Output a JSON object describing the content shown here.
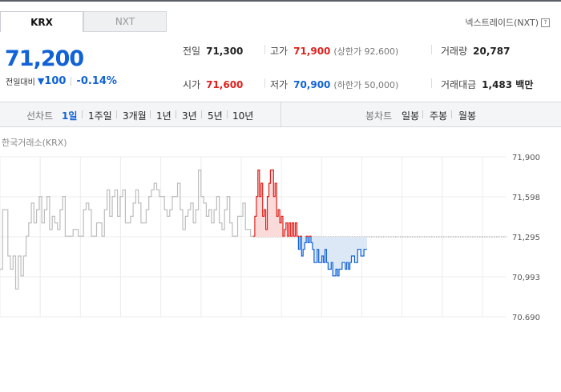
{
  "tabs": [
    {
      "label": "KRX",
      "active": true
    },
    {
      "label": "NXT",
      "active": false
    }
  ],
  "nxt_link": {
    "label": "넥스트레이드(NXT)",
    "help_icon": "?"
  },
  "price": {
    "current": "71,200",
    "change_label": "전일대비",
    "change_direction": "down",
    "change_arrow": "▼",
    "change": "100",
    "change_pct": "-0.14%"
  },
  "stats": {
    "prev_close": {
      "label": "전일",
      "value": "71,300"
    },
    "high": {
      "label": "고가",
      "value": "71,900",
      "sub": "(상한가 92,600)"
    },
    "volume": {
      "label": "거래량",
      "value": "20,787"
    },
    "open": {
      "label": "시가",
      "value": "71,600"
    },
    "low": {
      "label": "저가",
      "value": "70,900",
      "sub": "(하한가 50,000)"
    },
    "amount": {
      "label": "거래대금",
      "value": "1,483 백만"
    }
  },
  "period_bar": {
    "line_label": "선차트",
    "line_options": [
      "1일",
      "1주일",
      "3개월",
      "1년",
      "3년",
      "5년",
      "10년"
    ],
    "selected": "1일",
    "candle_label": "봉차트",
    "candle_options": [
      "일봉",
      "주봉",
      "월봉"
    ]
  },
  "chart_data": {
    "type": "line",
    "exchange_label": "한국거래소(KRX)",
    "y_ticks": [
      "71,900",
      "71,598",
      "71,295",
      "70,993",
      "70,690"
    ],
    "ylim": [
      70690,
      71900
    ],
    "baseline": 71295,
    "grid": true,
    "colors": {
      "pre": "#bdbdbd",
      "up": "#e0201c",
      "up_fill": "#fbdada",
      "down": "#1062d6",
      "down_fill": "#dde8f6",
      "baseline": "#777777"
    },
    "series": [
      {
        "session": "pre-market",
        "values": [
          71050,
          71500,
          71500,
          71150,
          71050,
          71150,
          70900,
          71150,
          71000,
          71150,
          71300,
          71400,
          71550,
          71400,
          71500,
          71600,
          71400,
          71500,
          71600,
          71350,
          71450,
          71400,
          71350,
          71500,
          71600,
          71300,
          71300,
          71300,
          71350,
          71350,
          71300,
          71300,
          71500,
          71550,
          71500,
          71300,
          71300,
          71400,
          71400,
          71300,
          71500,
          71650,
          71450,
          71600,
          71650,
          71450,
          71600,
          71650,
          71400,
          71400,
          71450,
          71550,
          71650,
          71550,
          71400,
          71400,
          71500,
          71600,
          71650,
          71700,
          71650,
          71600,
          71600,
          71500,
          71450,
          71500,
          71600,
          71600,
          71700,
          71500,
          71350,
          71450,
          71500,
          71550,
          71400,
          71500,
          71800,
          71600,
          71550,
          71450,
          71500,
          71400,
          71500,
          71600,
          71400,
          71350,
          71500,
          71600,
          71400,
          71300,
          71300,
          71450,
          71450,
          71550,
          71350,
          71350,
          71300,
          71300
        ]
      },
      {
        "session": "regular",
        "values": [
          71300,
          71450,
          71600,
          71800,
          71600,
          71700,
          71450,
          71500,
          71350,
          71600,
          71700,
          71800,
          71800,
          71600,
          71700,
          71450,
          71500,
          71400,
          71450,
          71300,
          71350,
          71400,
          71300,
          71400,
          71300,
          71400,
          71300,
          71400,
          71300,
          71200,
          71300,
          71150,
          71200,
          71250,
          71300,
          71250,
          71300,
          71250,
          71200,
          71100,
          71100,
          71200,
          71100,
          71100,
          71150,
          71100,
          71200,
          71100,
          71050,
          71050,
          71100,
          71000,
          71000,
          71050,
          71000,
          71050,
          71050,
          71100,
          71100,
          71050,
          71100,
          71050,
          71100,
          71150,
          71150,
          71100,
          71100,
          71200,
          71200,
          71150,
          71150,
          71200,
          71200,
          71200
        ]
      }
    ]
  }
}
